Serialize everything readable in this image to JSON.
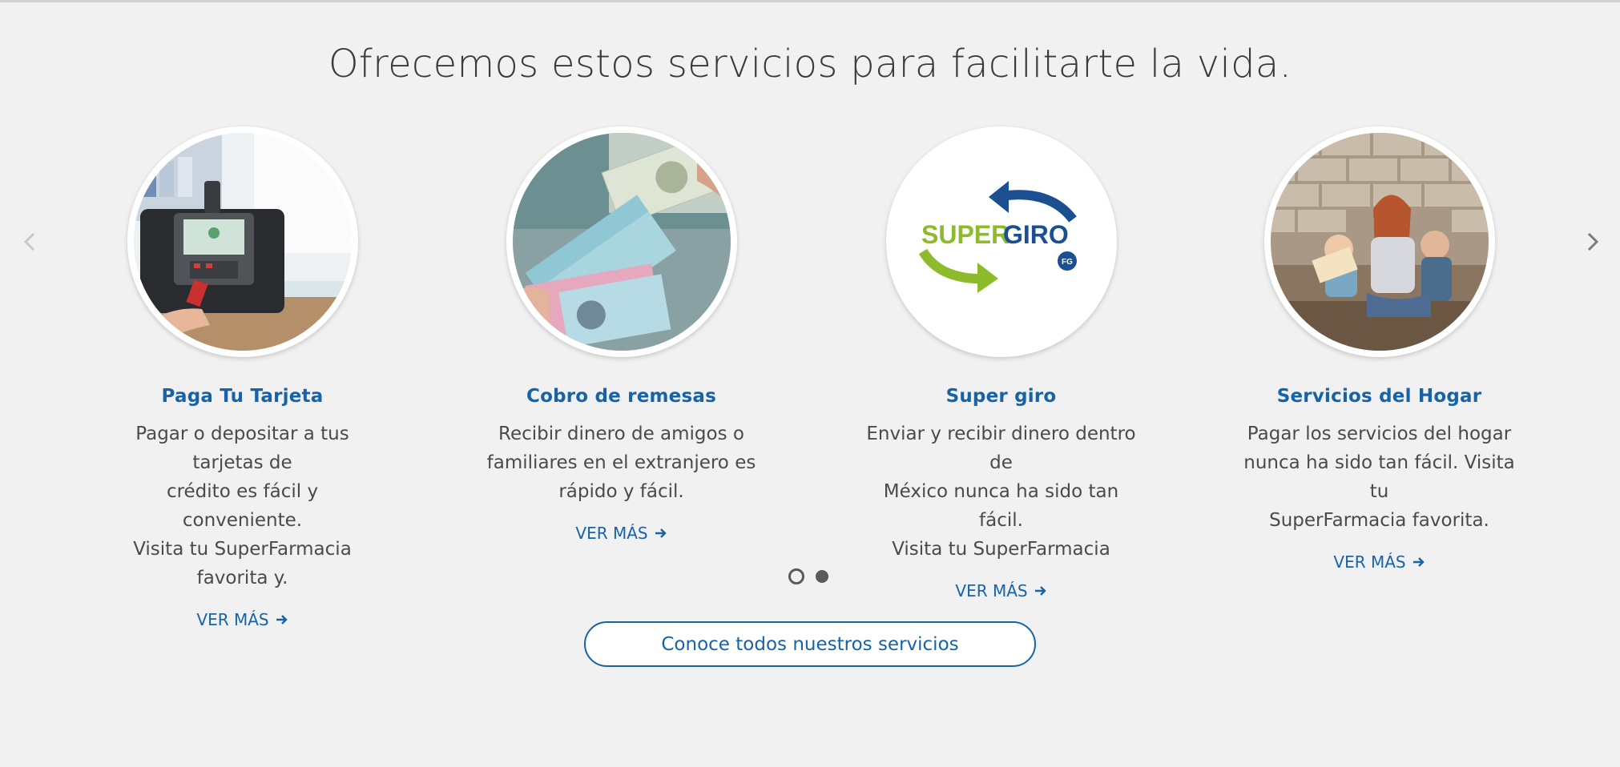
{
  "section": {
    "heading": "Ofrecemos estos servicios para facilitarte la vida."
  },
  "carousel": {
    "prev_icon": "chevron-left-icon",
    "next_icon": "chevron-right-icon",
    "cards": [
      {
        "title": "Paga Tu Tarjeta",
        "lines": [
          "Pagar o depositar a tus tarjetas de",
          "crédito es fácil y conveniente.",
          "Visita tu SuperFarmacia favorita y."
        ],
        "link": "VER MÁS"
      },
      {
        "title": "Cobro de remesas",
        "lines": [
          "Recibir dinero de amigos o",
          "familiares en el extranjero es",
          "rápido y fácil."
        ],
        "link": "VER MÁS"
      },
      {
        "title": "Super giro",
        "lines": [
          "Enviar y recibir dinero dentro de",
          "México nunca ha sido tan fácil.",
          "Visita tu SuperFarmacia"
        ],
        "link": "VER MÁS",
        "logo_text_1": "SUPER",
        "logo_text_2": "GIRO",
        "logo_badge": "FG"
      },
      {
        "title": "Servicios del Hogar",
        "lines": [
          "Pagar los servicios del hogar",
          "nunca ha sido tan fácil. Visita tu",
          "SuperFarmacia favorita."
        ],
        "link": "VER MÁS"
      }
    ],
    "dots": {
      "active_index": 1,
      "total": 2
    }
  },
  "cta": {
    "label": "Conoce todos nuestros servicios"
  },
  "colors": {
    "accent": "#1763a6",
    "background": "#f1f1f1",
    "text": "#4a4a4a",
    "logo_green": "#8dbb2b",
    "logo_blue": "#1b4f92"
  }
}
